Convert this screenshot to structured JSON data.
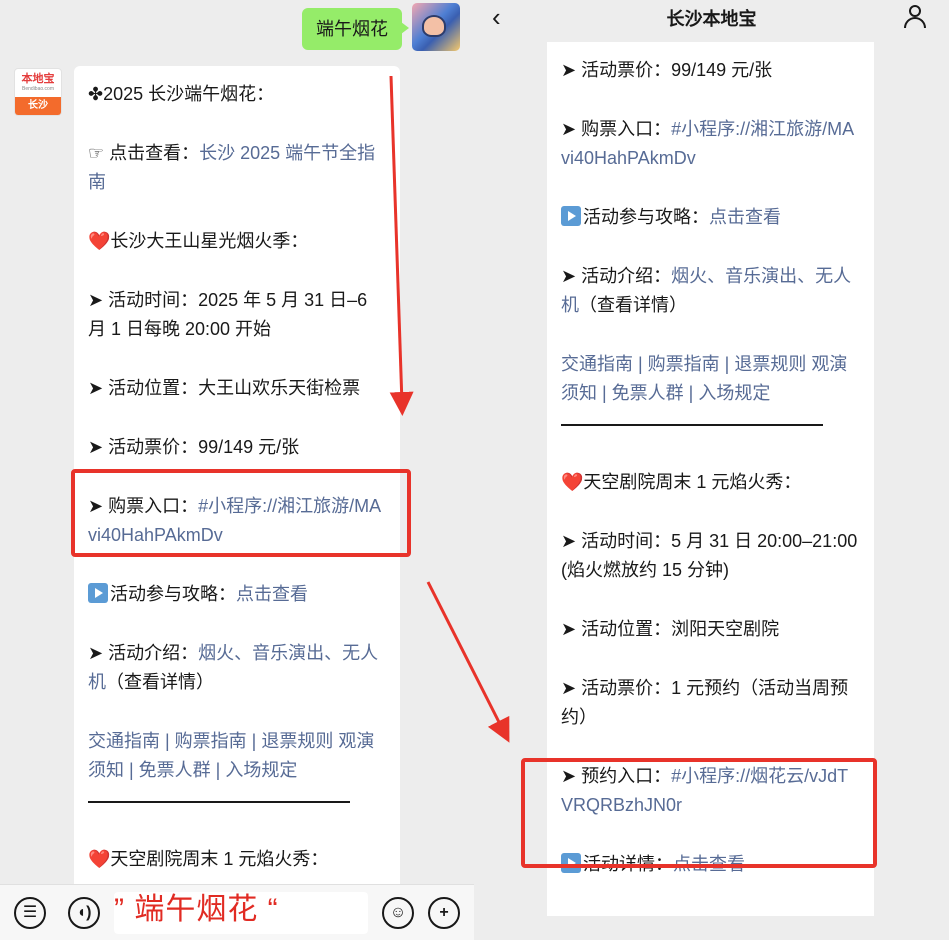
{
  "left": {
    "user_message": "端午烟花",
    "bot_avatar": {
      "top": "本地宝",
      "mid": "Bendibao.com",
      "bottom": "长沙"
    },
    "lines": [
      {
        "text": "✤2025 长沙端午烟花："
      },
      {
        "prefix": "☞ 点击查看：",
        "link": "长沙 2025 端午节全指南"
      },
      {
        "heart": "❤️",
        "text": "长沙大王山星光烟火季："
      },
      {
        "text": "➤ 活动时间：2025 年 5 月 31 日–6 月 1 日每晚 20:00 开始"
      },
      {
        "text": "➤ 活动位置：大王山欢乐天街检票"
      },
      {
        "text": "➤ 活动票价：99/149 元/张"
      },
      {
        "prefix": "➤ 购票入口：",
        "link": "#小程序://湘江旅游/MAvi40HahPAkmDv"
      },
      {
        "prefix": "活动参与攻略：",
        "link": "点击查看"
      },
      {
        "prefix": "➤ 活动介绍：",
        "link": "烟火、音乐演出、无人机",
        "suffix": "（查看详情）"
      },
      {
        "links": "交通指南 | 购票指南 | 退票规则 观演须知 | 免票人群 | 入场规定"
      },
      {
        "heart": "❤️",
        "text": "天空剧院周末 1 元焰火秀："
      }
    ]
  },
  "input_bar": {
    "overlay_text": "” 端午烟花 “"
  },
  "right": {
    "title": "长沙本地宝",
    "lines": [
      {
        "text": "➤ 活动票价：99/149 元/张"
      },
      {
        "prefix": "➤ 购票入口：",
        "link": "#小程序://湘江旅游/MAvi40HahPAkmDv"
      },
      {
        "prefix": "活动参与攻略：",
        "link": "点击查看"
      },
      {
        "prefix": "➤ 活动介绍：",
        "link": "烟火、音乐演出、无人机",
        "suffix": "（查看详情）"
      },
      {
        "links": "交通指南 | 购票指南 | 退票规则 观演须知 | 免票人群 | 入场规定"
      },
      {
        "heart": "❤️",
        "text": "天空剧院周末 1 元焰火秀："
      },
      {
        "text": "➤ 活动时间：5 月 31 日 20:00–21:00(焰火燃放约 15 分钟)"
      },
      {
        "text": "➤ 活动位置：浏阳天空剧院"
      },
      {
        "text": "➤ 活动票价：1 元预约（活动当周预约）"
      },
      {
        "prefix": "➤ 预约入口：",
        "link": "#小程序://烟花云/vJdTVRQRBzhJN0r"
      },
      {
        "prefix": "活动详情：",
        "link": "点击查看"
      }
    ]
  },
  "colors": {
    "link": "#576b95",
    "annotation_red": "#e8332a",
    "user_bubble": "#95ec69"
  },
  "icons": [
    "back-chevron-icon",
    "user-profile-icon",
    "voice-list-icon",
    "voice-wave-icon",
    "emoji-icon",
    "plus-icon",
    "play-icon"
  ]
}
